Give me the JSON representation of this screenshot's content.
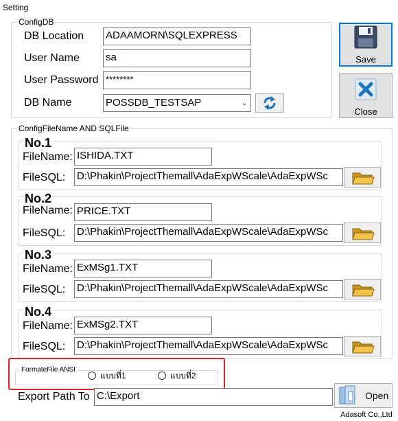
{
  "window": {
    "title": "Setting"
  },
  "config_db": {
    "legend": "ConfigDB",
    "db_location_label": "DB Location",
    "db_location_value": "ADAAMORN\\SQLEXPRESS",
    "user_name_label": "User Name",
    "user_name_value": "sa",
    "user_password_label": "User Password",
    "user_password_value": "********",
    "db_name_label": "DB Name",
    "db_name_value": "POSSDB_TESTSAP"
  },
  "buttons": {
    "save_label": "Save",
    "close_label": "Close",
    "open_label": "Open"
  },
  "config_files": {
    "legend": "ConfigFileName AND SQLFile",
    "filename_label": "FileName:",
    "filesql_label": "FileSQL:",
    "items": [
      {
        "title": "No.1",
        "filename": "ISHIDA.TXT",
        "filesql": "D:\\Phakin\\ProjectThemall\\AdaExpWScale\\AdaExpWSc"
      },
      {
        "title": "No.2",
        "filename": "PRICE.TXT",
        "filesql": "D:\\Phakin\\ProjectThemall\\AdaExpWScale\\AdaExpWSc"
      },
      {
        "title": "No.3",
        "filename": "ExMSg1.TXT",
        "filesql": "D:\\Phakin\\ProjectThemall\\AdaExpWScale\\AdaExpWSc"
      },
      {
        "title": "No.4",
        "filename": "ExMSg2.TXT",
        "filesql": "D:\\Phakin\\ProjectThemall\\AdaExpWScale\\AdaExpWSc"
      }
    ]
  },
  "format_file": {
    "legend": "FormateFile ANSI",
    "option1": "แบบที่1",
    "option2": "แบบที่2"
  },
  "export": {
    "label": "Export Path To",
    "value": "C:\\Export"
  },
  "footer": {
    "company": "Adasoft Co.,Ltd"
  },
  "colors": {
    "highlight": "#e0252a",
    "focus": "#0078d7",
    "folder": "#e8b43a"
  }
}
